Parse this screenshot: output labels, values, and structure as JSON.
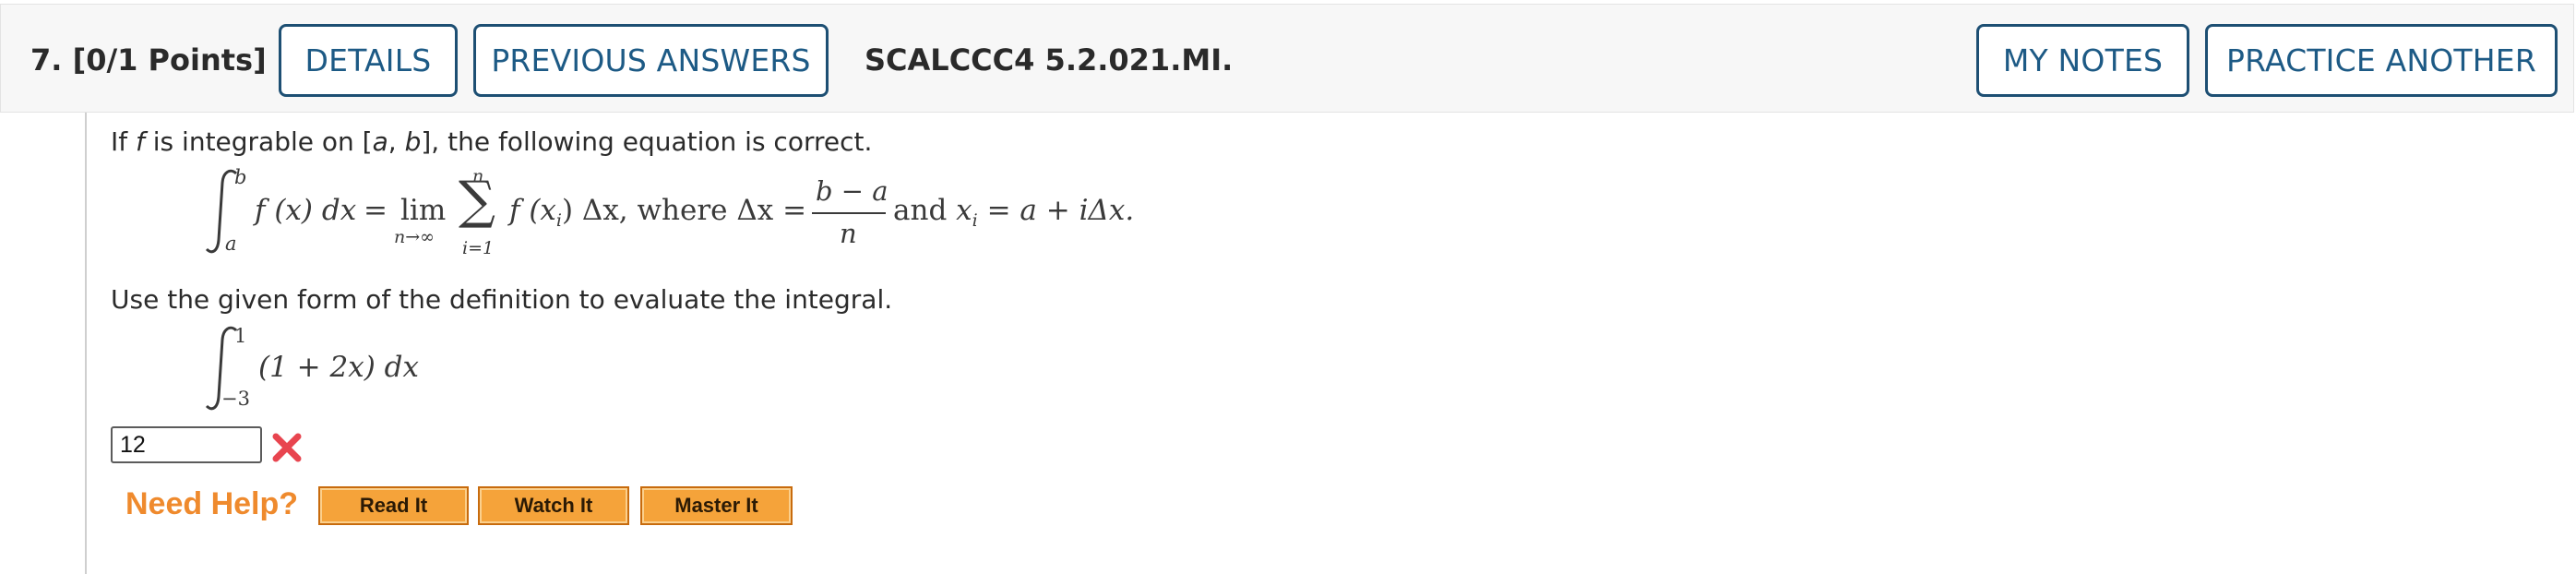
{
  "header": {
    "question_label": "7.  [0/1 Points]",
    "details_label": "DETAILS",
    "previous_answers_label": "PREVIOUS ANSWERS",
    "code": "SCALCCC4 5.2.021.MI.",
    "my_notes_label": "MY NOTES",
    "practice_another_label": "PRACTICE ANOTHER"
  },
  "problem": {
    "intro_prefix": "If ",
    "intro_f": "f",
    "intro_mid": " is integrable on [",
    "intro_a": "a",
    "intro_comma": ", ",
    "intro_b": "b",
    "intro_suffix": "], the following equation is correct.",
    "instruction": "Use the given form of the definition to evaluate the integral."
  },
  "formula": {
    "upper_b": "b",
    "lower_a": "a",
    "integrand": "f (x) dx",
    "equals": "=",
    "lim": "lim",
    "lim_sub": "n→∞",
    "sum_upper": "n",
    "sum_lower": "i=1",
    "sum_term": "f (x",
    "sum_term_sub": "i",
    "sum_term_end": ") Δx, where Δx =",
    "frac_num": "b − a",
    "frac_den": "n",
    "and_text": "and",
    "xi_lhs": "x",
    "xi_sub": "i",
    "xi_rhs": "= a + iΔx."
  },
  "integral": {
    "upper": "1",
    "lower": "−3",
    "integrand": "(1 + 2x) dx"
  },
  "answer": {
    "value": "12",
    "status": "incorrect"
  },
  "help": {
    "label": "Need Help?",
    "read_it": "Read It",
    "watch_it": "Watch It",
    "master_it": "Master It"
  },
  "colors": {
    "button_border": "#1d4f73",
    "button_text": "#1d5a85",
    "need_help": "#ef8a2d",
    "help_button_bg": "#f5a33a",
    "incorrect_mark": "#e8454f"
  }
}
